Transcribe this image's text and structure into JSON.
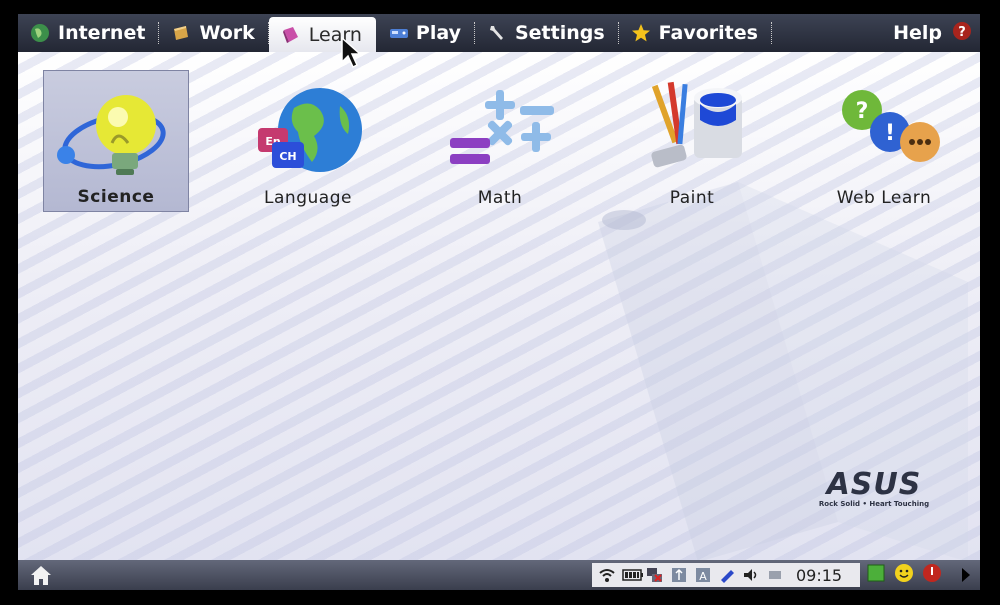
{
  "tabs": [
    {
      "label": "Internet",
      "icon": "globe-icon",
      "active": false
    },
    {
      "label": "Work",
      "icon": "briefcase-icon",
      "active": false
    },
    {
      "label": "Learn",
      "icon": "book-icon",
      "active": true
    },
    {
      "label": "Play",
      "icon": "game-icon",
      "active": false
    },
    {
      "label": "Settings",
      "icon": "wrench-icon",
      "active": false
    },
    {
      "label": "Favorites",
      "icon": "star-icon",
      "active": false
    }
  ],
  "help": {
    "label": "Help",
    "icon": "question-icon"
  },
  "apps": [
    {
      "label": "Science",
      "icon": "lightbulb-atom-icon",
      "selected": true
    },
    {
      "label": "Language",
      "icon": "globe-language-icon",
      "selected": false
    },
    {
      "label": "Math",
      "icon": "math-symbols-icon",
      "selected": false
    },
    {
      "label": "Paint",
      "icon": "paint-bucket-icon",
      "selected": false
    },
    {
      "label": "Web Learn",
      "icon": "question-info-bubbles-icon",
      "selected": false
    }
  ],
  "language_icon_badges": {
    "top": "En",
    "bottom": "CH"
  },
  "brand": {
    "name": "ASUS",
    "tagline": "Rock Solid • Heart Touching"
  },
  "taskbar": {
    "clock": "09:15",
    "tray_icons": [
      "wifi-icon",
      "battery-icon",
      "network-disconnected-icon",
      "usb-icon",
      "keyboard-layout-icon",
      "pen-icon",
      "volume-icon",
      "display-icon"
    ],
    "right_icons": [
      "green-square-icon",
      "smiley-icon",
      "power-icon"
    ]
  },
  "colors": {
    "tabbar": "#2b303e",
    "help_badge": "#a8241d",
    "active_tab": "#ffffff"
  }
}
